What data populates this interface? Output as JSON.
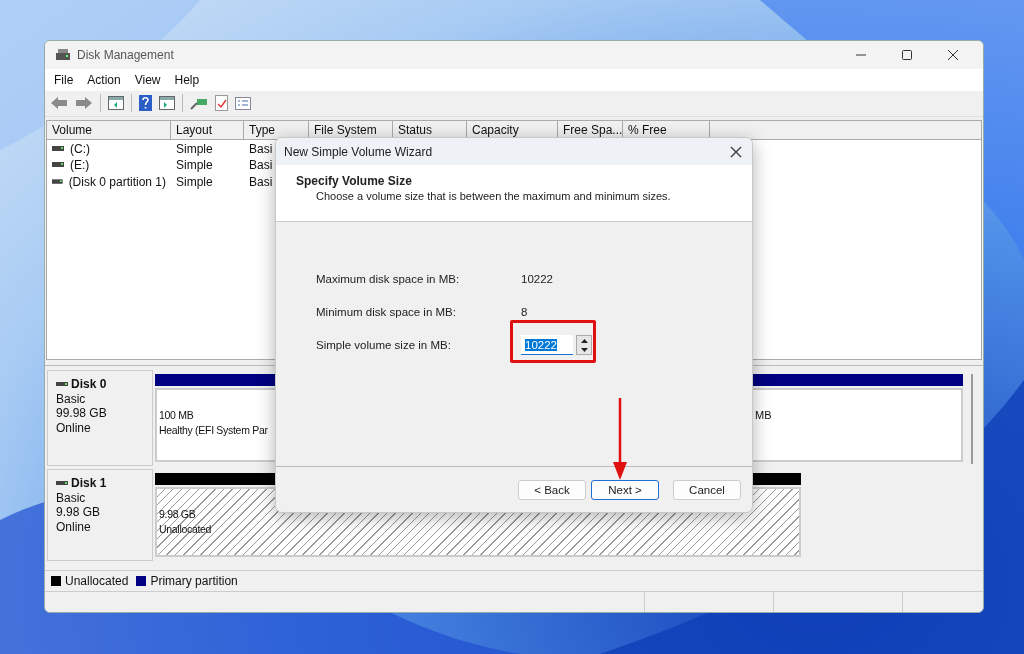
{
  "window": {
    "title": "Disk Management"
  },
  "menu": [
    "File",
    "Action",
    "View",
    "Help"
  ],
  "volume_table": {
    "columns": [
      "Volume",
      "Layout",
      "Type",
      "File System",
      "Status",
      "Capacity",
      "Free Spa...",
      "% Free"
    ],
    "rows": [
      {
        "volume": "(C:)",
        "layout": "Simple",
        "type": "Basi"
      },
      {
        "volume": "(E:)",
        "layout": "Simple",
        "type": "Basi"
      },
      {
        "volume": "(Disk 0 partition 1)",
        "layout": "Simple",
        "type": "Basi"
      }
    ]
  },
  "disks": [
    {
      "name": "Disk 0",
      "type": "Basic",
      "size": "99.98 GB",
      "status": "Online",
      "partitions": [
        {
          "kind": "primary",
          "size": "100 MB",
          "status": "Healthy (EFI System Par"
        },
        {
          "kind": "primary",
          "size": "MB"
        }
      ]
    },
    {
      "name": "Disk 1",
      "type": "Basic",
      "size": "9.98 GB",
      "status": "Online",
      "partitions": [
        {
          "kind": "unallocated",
          "size": "9.98 GB",
          "status": "Unallocated"
        }
      ]
    }
  ],
  "legend": [
    {
      "label": "Unallocated",
      "color": "#000000"
    },
    {
      "label": "Primary partition",
      "color": "#000080"
    }
  ],
  "dialog": {
    "title": "New Simple Volume Wizard",
    "heading": "Specify Volume Size",
    "subheading": "Choose a volume size that is between the maximum and minimum sizes.",
    "fields": [
      {
        "kind": "readout",
        "label": "Maximum disk space in MB:",
        "value": "10222"
      },
      {
        "kind": "readout",
        "label": "Minimum disk space in MB:",
        "value": "8"
      },
      {
        "kind": "spinner",
        "label": "Simple volume size in MB:",
        "value": "10222",
        "selected": true
      }
    ],
    "buttons": [
      {
        "label": "< Back",
        "focused": false
      },
      {
        "label": "Next >",
        "focused": true
      },
      {
        "label": "Cancel",
        "focused": false
      }
    ]
  }
}
